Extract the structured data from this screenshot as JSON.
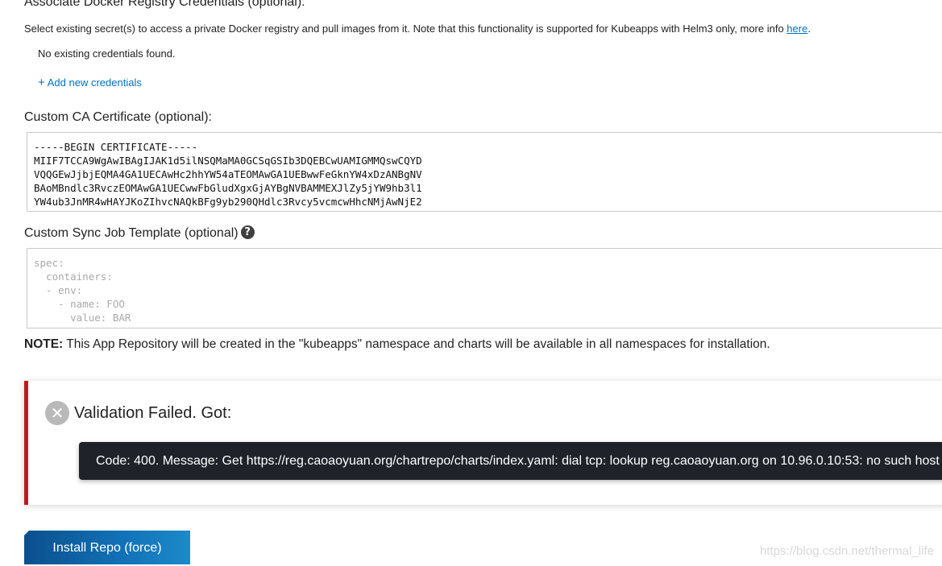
{
  "docker": {
    "heading": "Associate Docker Registry Credentials (optional):",
    "help": "Select existing secret(s) to access a private Docker registry and pull images from it. Note that this functionality is supported for Kubeapps with Helm3 only, more info ",
    "help_link": "here",
    "help_end": ".",
    "empty_text": "No existing credentials found.",
    "add_icon": "plus-icon",
    "add_label": "Add new credentials"
  },
  "ca": {
    "label": "Custom CA Certificate (optional):",
    "value": "-----BEGIN CERTIFICATE-----\nMIIF7TCCA9WgAwIBAgIJAK1d5ilNSQMaMA0GCSqGSIb3DQEBCwUAMIGMMQswCQYD\nVQQGEwJjbjEQMA4GA1UECAwHc2hhYW54aTEOMAwGA1UEBwwFeGknYW4xDzANBgNV\nBAoMBndlc3RvczEOMAwGA1UECwwFbGludXgxGjAYBgNVBAMMEXJlZy5jYW9hb3l1\nYW4ub3JnMR4wHAYJKoZIhvcNAQkBFg9yb290QHdlc3Rvcy5vcmcwHhcNMjAwNjE2"
  },
  "sync": {
    "label": "Custom Sync Job Template (optional)",
    "help_icon": "question-icon",
    "help_glyph": "?",
    "placeholder": "spec:\n  containers:\n  - env:\n    - name: FOO\n      value: BAR"
  },
  "note": {
    "bold": "NOTE:",
    "text": " This App Repository will be created in the \"kubeapps\" namespace and charts will be available in all namespaces for installation."
  },
  "alert": {
    "icon": "close-circle-icon",
    "icon_glyph": "✕",
    "title": "Validation Failed. Got:",
    "message": "Code: 400. Message: Get https://reg.caoaoyuan.org/chartrepo/charts/index.yaml: dial tcp: lookup reg.caoaoyuan.org on 10.96.0.10:53: no such host",
    "border_color": "#c21a1a"
  },
  "install_button": "Install Repo (force)",
  "watermark": "https://blog.csdn.net/thermal_life",
  "colors": {
    "link": "#0072c6",
    "button": "#1272b8",
    "tooltip_bg": "#1f2329"
  }
}
